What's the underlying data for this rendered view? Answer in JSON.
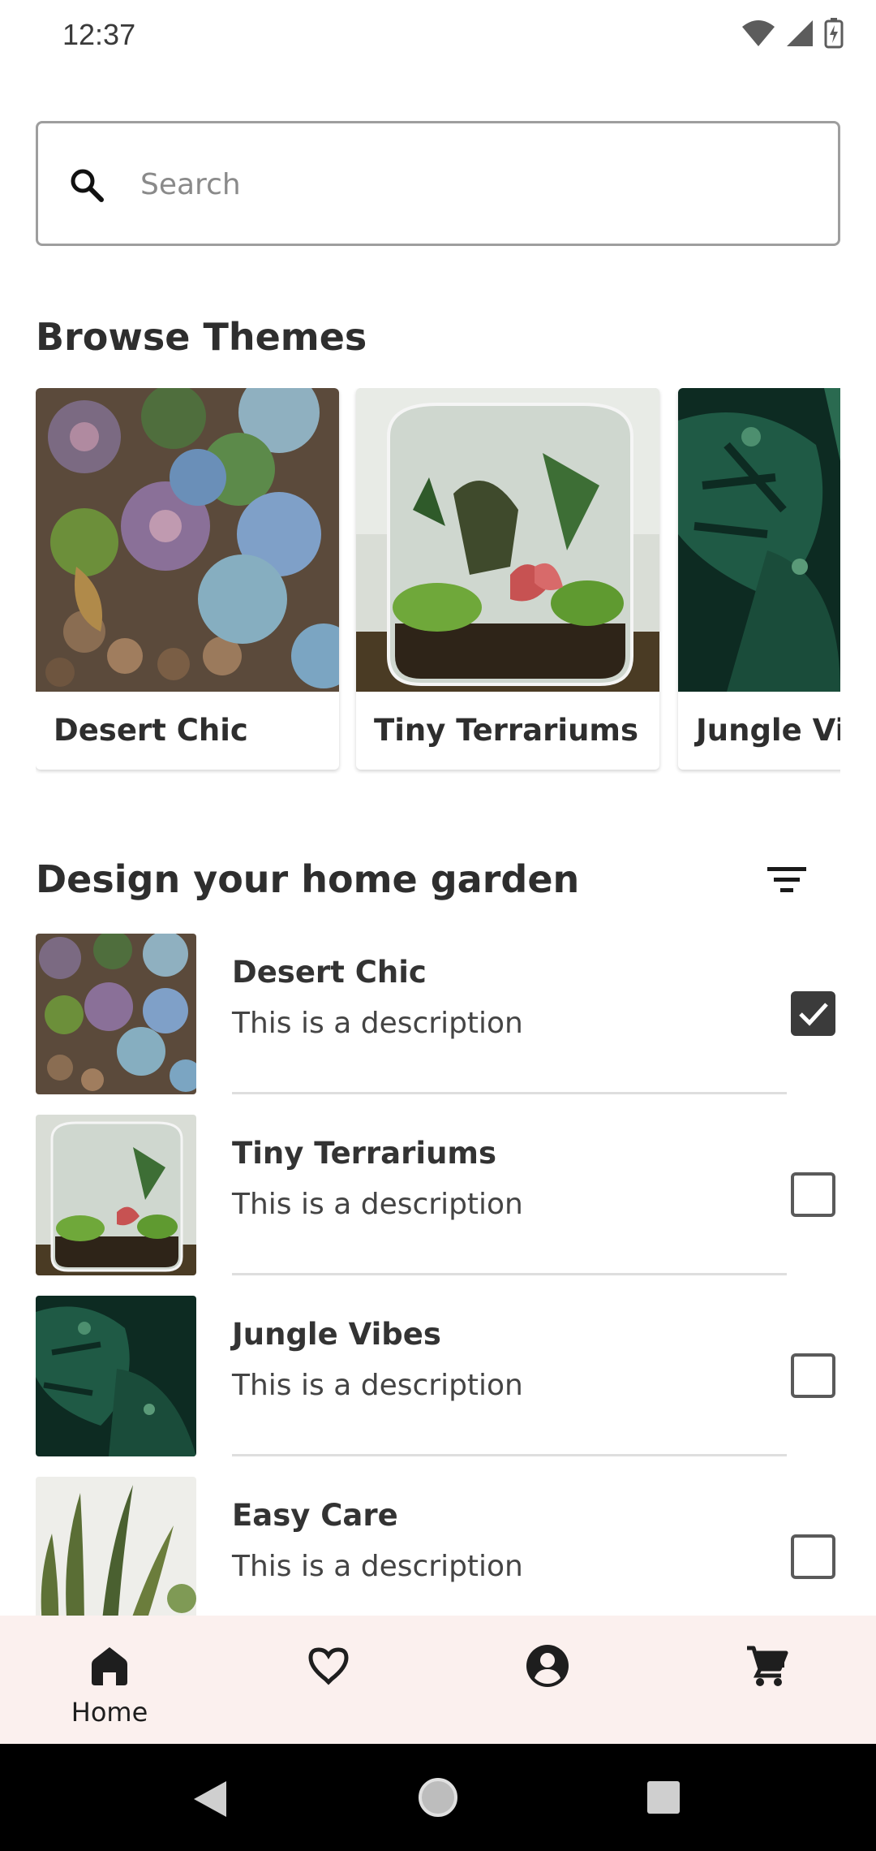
{
  "status_bar": {
    "time": "12:37"
  },
  "search": {
    "placeholder": "Search"
  },
  "browse_themes": {
    "title": "Browse Themes",
    "cards": [
      {
        "label": "Desert Chic",
        "image": "succulents-image"
      },
      {
        "label": "Tiny Terrariums",
        "image": "terrarium-image"
      },
      {
        "label": "Jungle Vibes",
        "image": "monstera-image"
      }
    ]
  },
  "garden": {
    "title": "Design your home garden",
    "items": [
      {
        "title": "Desert Chic",
        "description": "This is a description",
        "checked": true
      },
      {
        "title": "Tiny Terrariums",
        "description": "This is a description",
        "checked": false
      },
      {
        "title": "Jungle Vibes",
        "description": "This is a description",
        "checked": false
      },
      {
        "title": "Easy Care",
        "description": "This is a description",
        "checked": false
      }
    ]
  },
  "bottom_nav": {
    "items": [
      {
        "label": "Home",
        "icon": "home-icon",
        "active": true
      },
      {
        "label": "",
        "icon": "heart-icon",
        "active": false
      },
      {
        "label": "",
        "icon": "account-icon",
        "active": false
      },
      {
        "label": "",
        "icon": "cart-icon",
        "active": false
      }
    ]
  },
  "colors": {
    "nav_background": "#fbf0ee",
    "checkbox_checked": "#3b3b3b",
    "text_primary": "#2e2e2e"
  }
}
